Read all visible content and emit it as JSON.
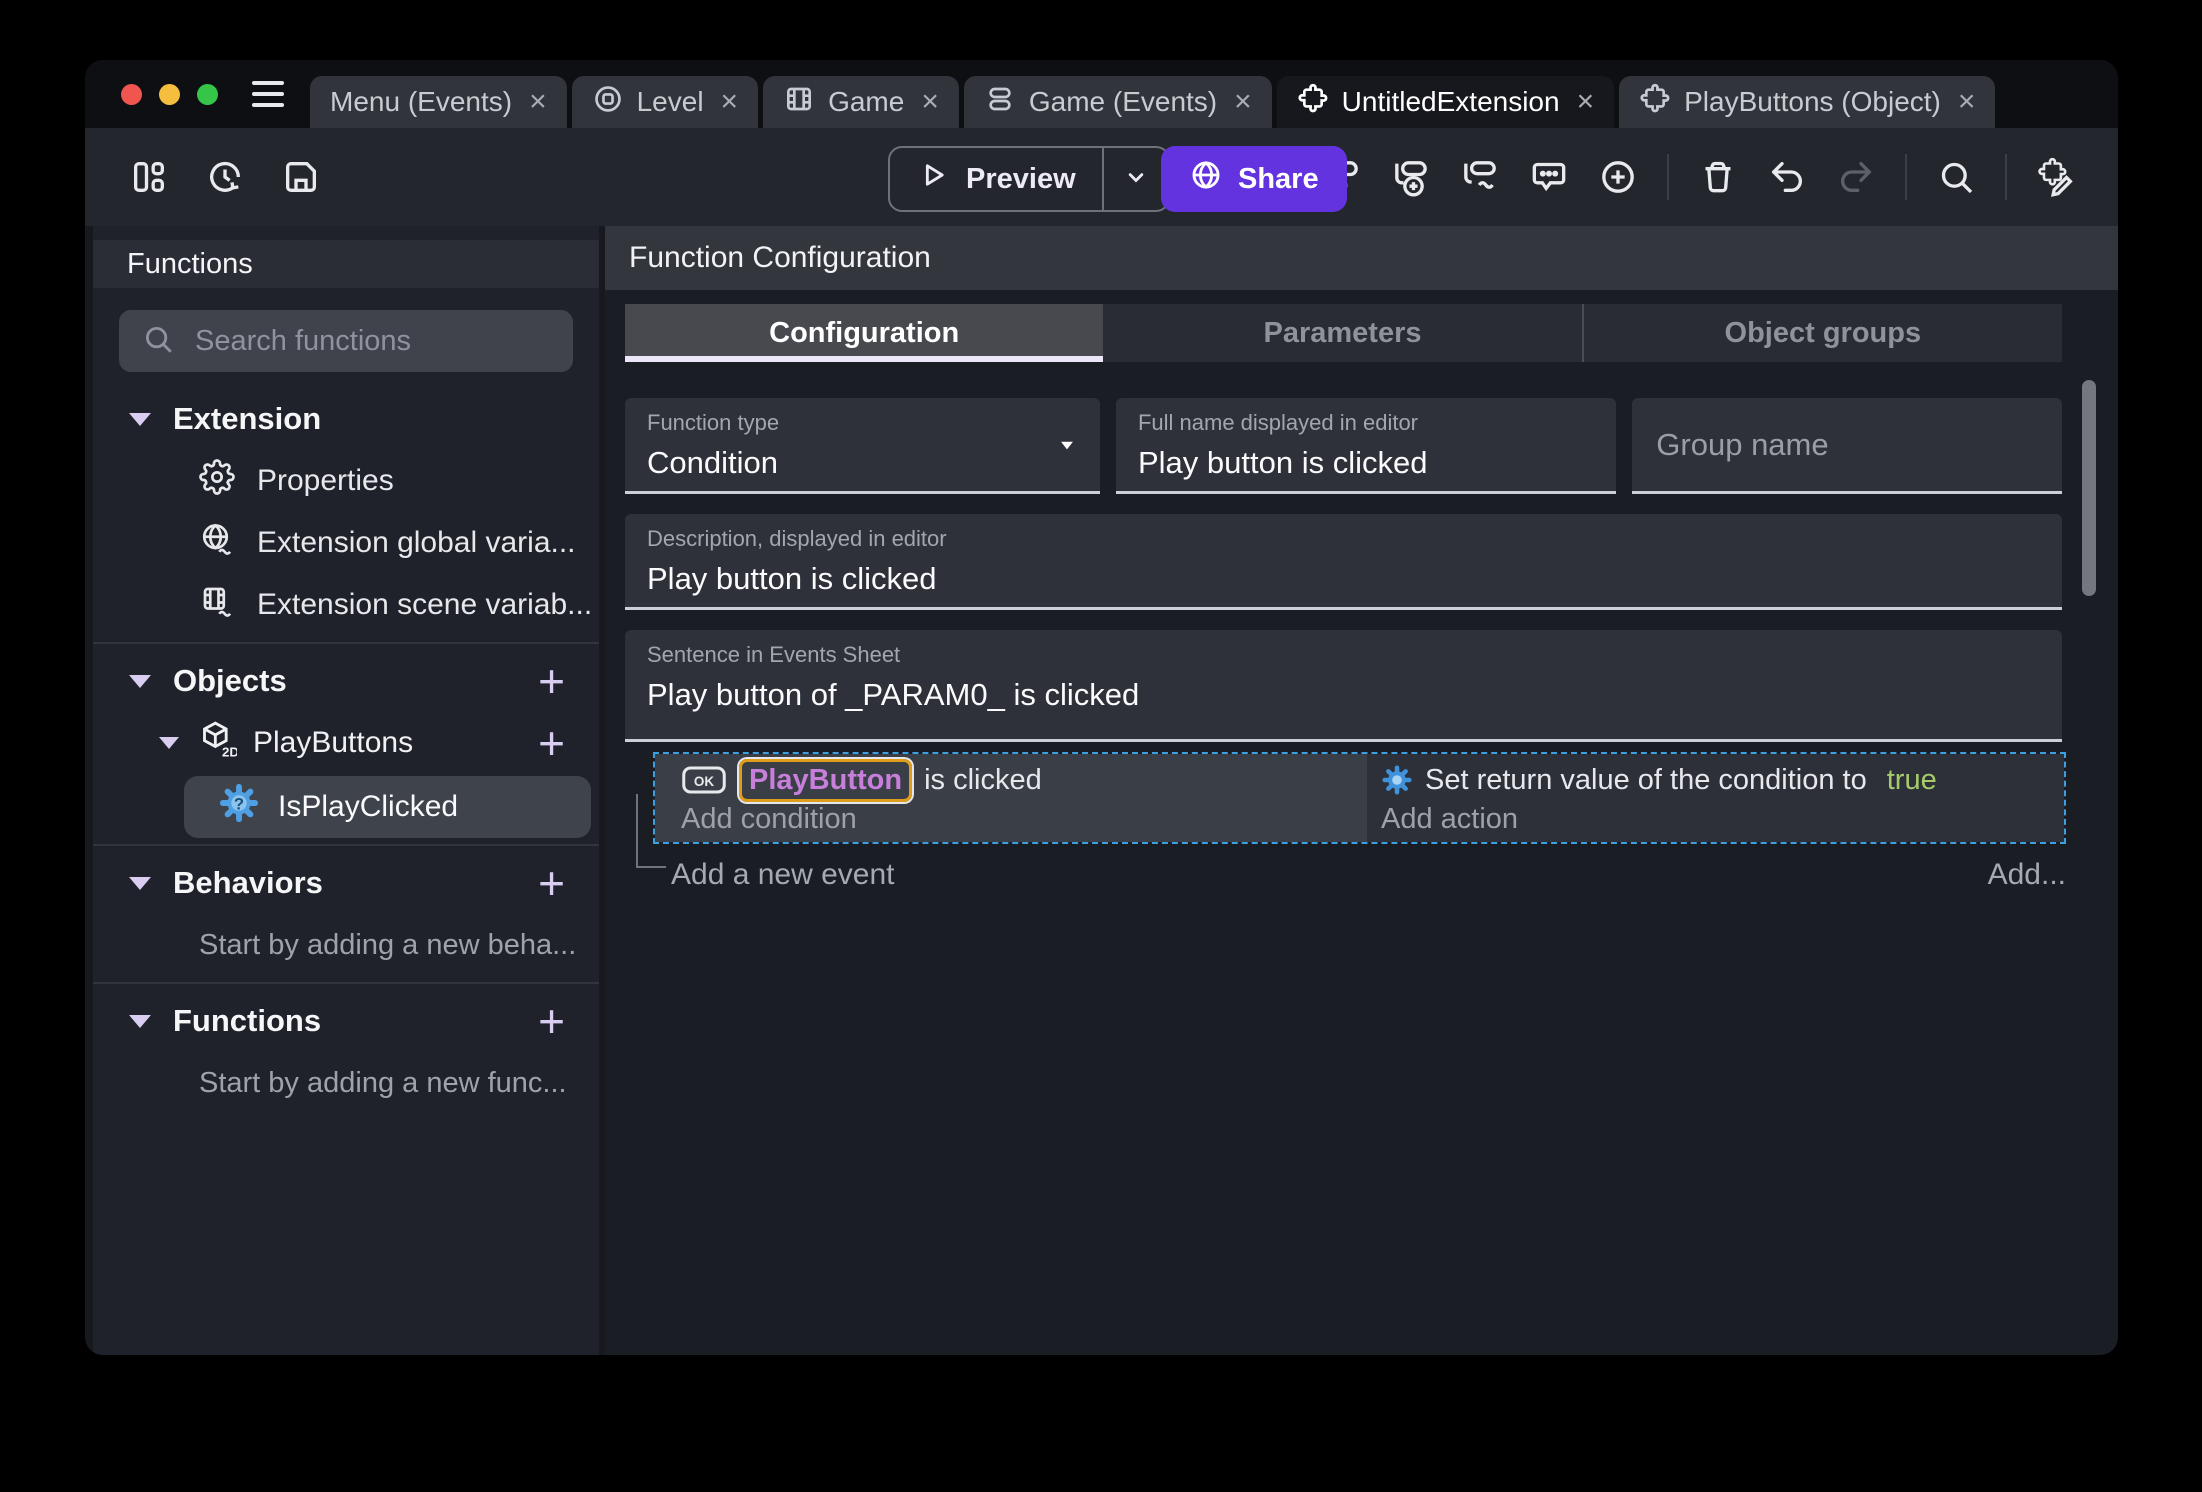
{
  "colors": {
    "accent_purple": "#6333E0",
    "selection_dashed_blue": "#3E9FE0",
    "object_highlight_orange": "#DE9E1C",
    "object_text_purple": "#C77FDB",
    "true_value_green": "#A5CB6B",
    "function_icon_blue": "#4E9FE4",
    "lavender_tree_accent": "#D9CDF1",
    "traffic_red": "#F0564F",
    "traffic_yellow": "#F5BE3E",
    "traffic_green": "#35C648"
  },
  "window": {
    "traffic_lights": [
      "close",
      "minimize",
      "zoom"
    ],
    "tabs": [
      {
        "icon": "",
        "label": "Menu (Events)",
        "close": "×",
        "active": false
      },
      {
        "icon": "scene-icon",
        "label": "Level",
        "close": "×",
        "active": false
      },
      {
        "icon": "film-icon",
        "label": "Game",
        "close": "×",
        "active": false
      },
      {
        "icon": "events-list-icon",
        "label": "Game (Events)",
        "close": "×",
        "active": false
      },
      {
        "icon": "puzzle-icon",
        "label": "UntitledExtension",
        "close": "×",
        "active": true
      },
      {
        "icon": "puzzle-icon",
        "label": "PlayButtons (Object)",
        "close": "×",
        "active": false
      }
    ]
  },
  "toolbar": {
    "left_icons": [
      "project-manager-icon",
      "version-history-icon",
      "save-icon"
    ],
    "preview_label": "Preview",
    "share_label": "Share",
    "right_icons": [
      "add-event-icon",
      "add-subevent-icon",
      "add-other-event-icon",
      "add-comment-icon",
      "add-circle-icon",
      "trash-icon",
      "undo-icon",
      "redo-icon",
      "search-icon",
      "edit-extension-icon"
    ]
  },
  "sidebar": {
    "title": "Functions",
    "search_placeholder": "Search functions",
    "sections": {
      "extension": {
        "label": "Extension",
        "items": [
          {
            "icon": "gear-icon",
            "label": "Properties"
          },
          {
            "icon": "globe-variable-icon",
            "label": "Extension global varia..."
          },
          {
            "icon": "scene-variable-icon",
            "label": "Extension scene variab..."
          }
        ]
      },
      "objects": {
        "label": "Objects",
        "add": "+",
        "object": {
          "label": "PlayButtons",
          "add": "+",
          "badge": "2D"
        },
        "function": {
          "label": "IsPlayClicked",
          "glyph": "?"
        }
      },
      "behaviors": {
        "label": "Behaviors",
        "add": "+",
        "hint": "Start by adding a new beha..."
      },
      "functions": {
        "label": "Functions",
        "add": "+",
        "hint": "Start by adding a new func..."
      }
    }
  },
  "main": {
    "title": "Function Configuration",
    "tabs": [
      {
        "label": "Configuration",
        "active": true
      },
      {
        "label": "Parameters",
        "active": false
      },
      {
        "label": "Object groups",
        "active": false
      }
    ],
    "fields": {
      "function_type": {
        "label": "Function type",
        "value": "Condition"
      },
      "full_name": {
        "label": "Full name displayed in editor",
        "value": "Play button is clicked"
      },
      "group_name": {
        "placeholder": "Group name"
      },
      "description": {
        "label": "Description, displayed in editor",
        "value": "Play button is clicked"
      },
      "sentence": {
        "label": "Sentence in Events Sheet",
        "value": "Play button of _PARAM0_ is clicked"
      }
    },
    "events": {
      "object_icon_label": "OK",
      "condition_object": "PlayButton",
      "condition_text": "is clicked",
      "add_condition": "Add condition",
      "action_text": "Set return value of the condition to",
      "action_value": "true",
      "add_action": "Add action",
      "add_new_event": "Add a new event",
      "add_more": "Add..."
    }
  }
}
